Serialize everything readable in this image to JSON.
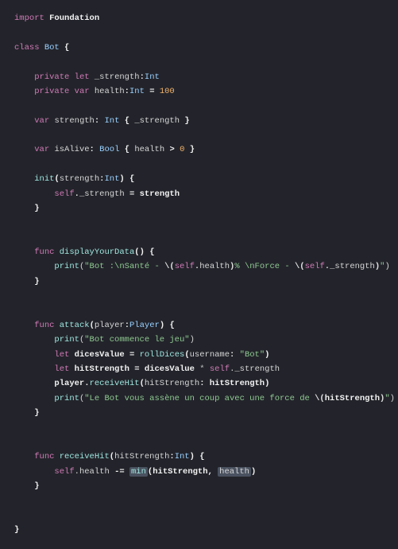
{
  "code": {
    "l1_kw": "import",
    "l1_type": "Foundation",
    "l3_kw": "class",
    "l3_name": "Bot",
    "l3_brace": "{",
    "l5_priv": "private",
    "l5_let": "let",
    "l5_name": "_strength",
    "l5_colon": ":",
    "l5_type": "Int",
    "l6_priv": "private",
    "l6_var": "var",
    "l6_name": "health",
    "l6_colon": ":",
    "l6_type": "Int",
    "l6_eq": "=",
    "l6_val": "100",
    "l8_var": "var",
    "l8_name": "strength",
    "l8_colon": ":",
    "l8_type": "Int",
    "l8_open": "{",
    "l8_expr": "_strength",
    "l8_close": "}",
    "l10_var": "var",
    "l10_name": "isAlive",
    "l10_colon": ":",
    "l10_type": "Bool",
    "l10_open": "{",
    "l10_expr_l": "health",
    "l10_expr_op": ">",
    "l10_expr_r": "0",
    "l10_close": "}",
    "l12_init": "init",
    "l12_param": "strength",
    "l12_ptype": "Int",
    "l12_open": "{",
    "l13_self": "self",
    "l13_dot": ".",
    "l13_prop": "_strength",
    "l13_eq": "=",
    "l13_val": "strength",
    "l14_close": "}",
    "l17_func": "func",
    "l17_name": "displayYourData",
    "l17_paren": "()",
    "l17_open": "{",
    "l18_print": "print",
    "l18_str_a": "\"Bot :\\nSanté - ",
    "l18_int1": "\\(",
    "l18_int1e_self": "self",
    "l18_int1e_dot": ".",
    "l18_int1e_prop": "health",
    "l18_int1c": ")",
    "l18_str_b": "% \\nForce - ",
    "l18_int2": "\\(",
    "l18_int2e_self": "self",
    "l18_int2e_dot": ".",
    "l18_int2e_prop": "_strength",
    "l18_int2c": ")",
    "l18_str_c": "\"",
    "l19_close": "}",
    "l22_func": "func",
    "l22_name": "attack",
    "l22_param": "player",
    "l22_ptype": "Player",
    "l22_open": "{",
    "l23_print": "print",
    "l23_str": "\"Bot commence le jeu\"",
    "l24_let": "let",
    "l24_name": "dicesValue",
    "l24_eq": "=",
    "l24_fn": "rollDices",
    "l24_argk": "username",
    "l24_argv": "\"Bot\"",
    "l25_let": "let",
    "l25_name": "hitStrength",
    "l25_eq": "=",
    "l25_a": "dicesValue",
    "l25_op": "*",
    "l25_self": "self",
    "l25_dot": ".",
    "l25_b": "_strength",
    "l26_recv": "player",
    "l26_dot": ".",
    "l26_fn": "receiveHit",
    "l26_argk": "hitStrength",
    "l26_argv": "hitStrength",
    "l27_print": "print",
    "l27_str_a": "\"Le Bot vous assène un coup avec une force de ",
    "l27_int": "\\(",
    "l27_inte": "hitStrength",
    "l27_intc": ")",
    "l27_str_b": "\"",
    "l28_close": "}",
    "l31_func": "func",
    "l31_name": "receiveHit",
    "l31_param": "hitStrength",
    "l31_ptype": "Int",
    "l31_open": "{",
    "l32_self": "self",
    "l32_dot": ".",
    "l32_prop": "health",
    "l32_op": "-=",
    "l32_min": "min",
    "l32_paren_o": "(",
    "l32_a": "hitStrength",
    "l32_comma": ",",
    "l32_b": "health",
    "l32_paren_c": ")",
    "l33_close": "}",
    "l36_close": "}"
  }
}
